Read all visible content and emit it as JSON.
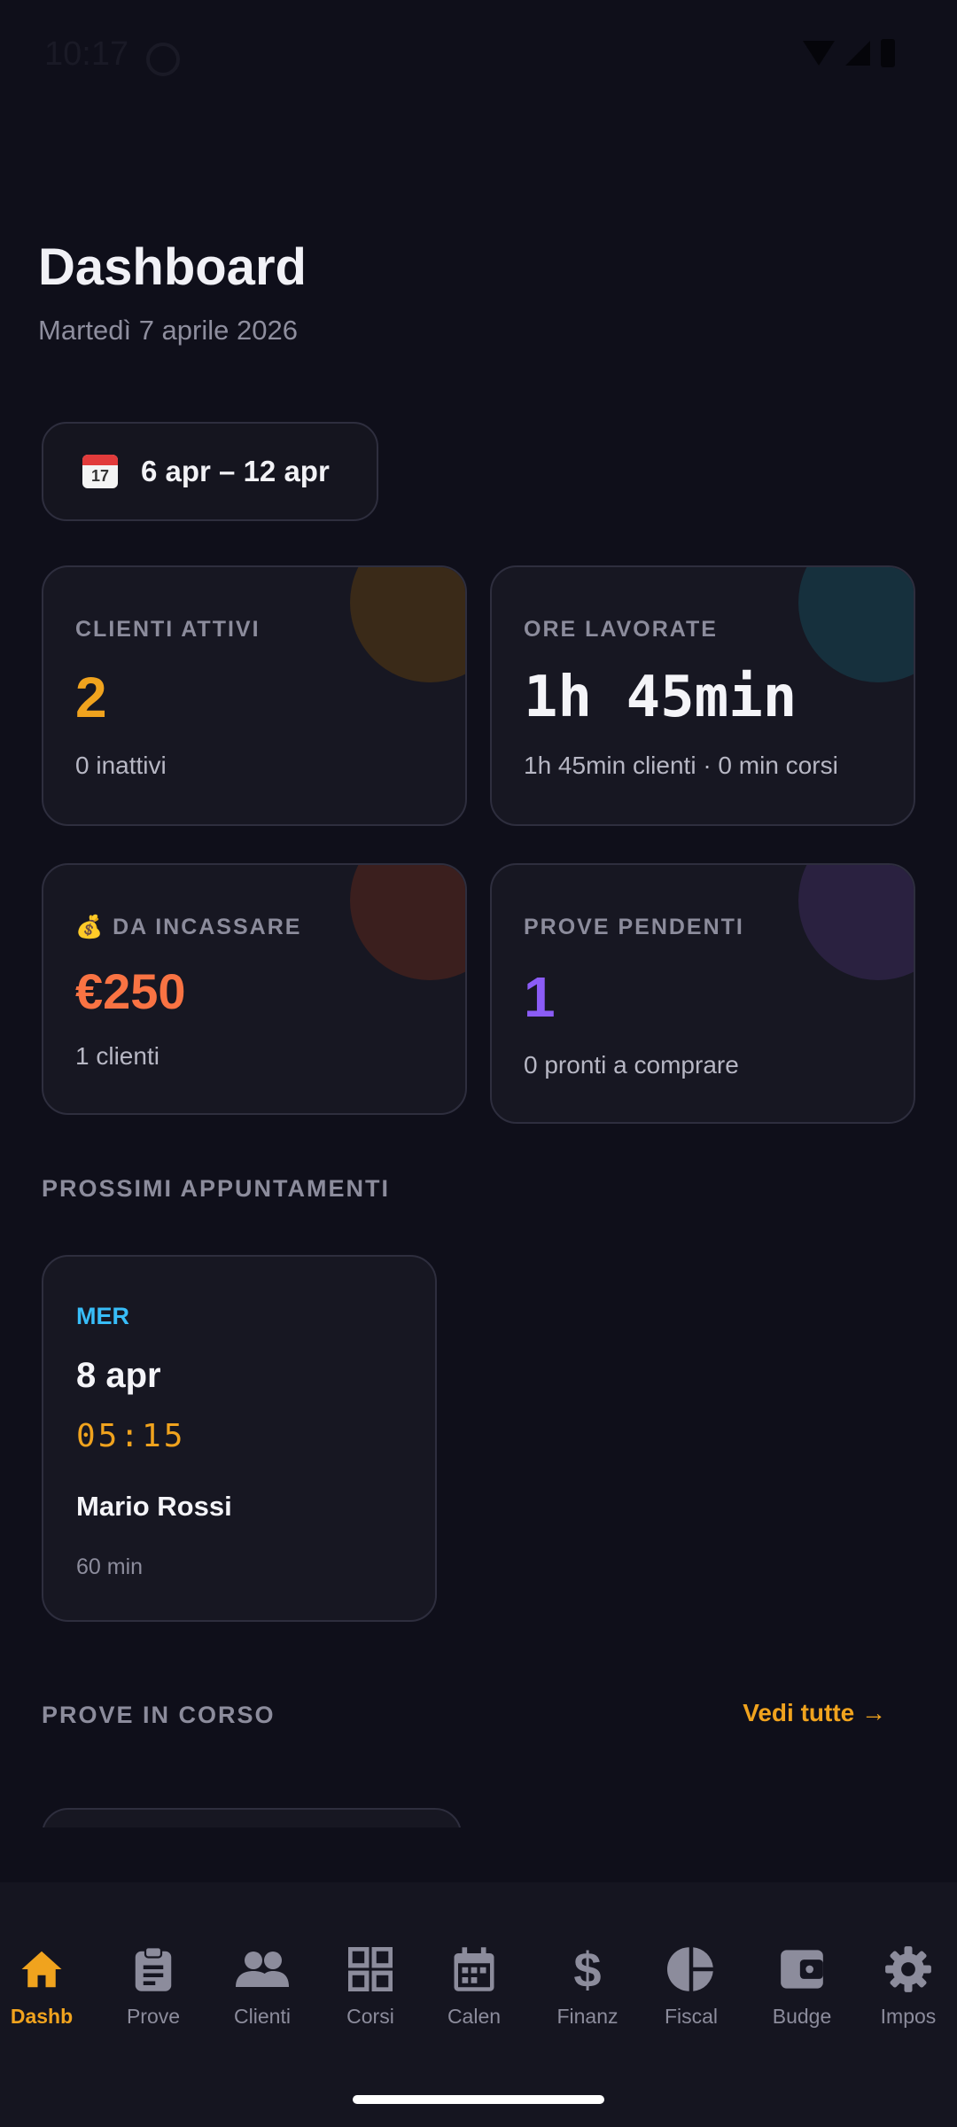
{
  "status_bar": {
    "time": "10:17"
  },
  "header": {
    "title": "Dashboard",
    "date": "Martedì 7 aprile 2026"
  },
  "week_selector": {
    "icon_text": "17",
    "label": "6 apr – 12 apr"
  },
  "stats": {
    "active_clients": {
      "label": "CLIENTI ATTIVI",
      "value": "2",
      "sub": "0 inattivi",
      "accent": "#f0a31e"
    },
    "hours_worked": {
      "label": "ORE LAVORATE",
      "value": "1h 45min",
      "sub": "1h 45min clienti · 0 min corsi",
      "accent": "#38bdf8"
    },
    "to_collect": {
      "label": "💰 DA INCASSARE",
      "value": "€250",
      "sub": "1 clienti",
      "accent": "#f97343"
    },
    "pending_trials": {
      "label": "PROVE PENDENTI",
      "value": "1",
      "sub": "0 pronti a comprare",
      "accent": "#8b5cf6"
    }
  },
  "upcoming": {
    "title": "PROSSIMI APPUNTAMENTI",
    "appointments": [
      {
        "day": "MER",
        "date": "8 apr",
        "time": "05:15",
        "client": "Mario Rossi",
        "duration": "60 min"
      }
    ]
  },
  "trials": {
    "title": "PROVE IN CORSO",
    "see_all": "Vedi tutte →"
  },
  "nav": [
    {
      "label": "Dashb",
      "icon": "home-icon",
      "active": true
    },
    {
      "label": "Prove",
      "icon": "clipboard-icon"
    },
    {
      "label": "Clienti",
      "icon": "people-icon"
    },
    {
      "label": "Corsi",
      "icon": "grid-icon"
    },
    {
      "label": "Calen",
      "icon": "calendar-icon"
    },
    {
      "label": "Finanz",
      "icon": "dollar-icon"
    },
    {
      "label": "Fiscal",
      "icon": "pie-chart-icon"
    },
    {
      "label": "Budge",
      "icon": "wallet-icon"
    },
    {
      "label": "Impos",
      "icon": "gear-icon"
    }
  ]
}
